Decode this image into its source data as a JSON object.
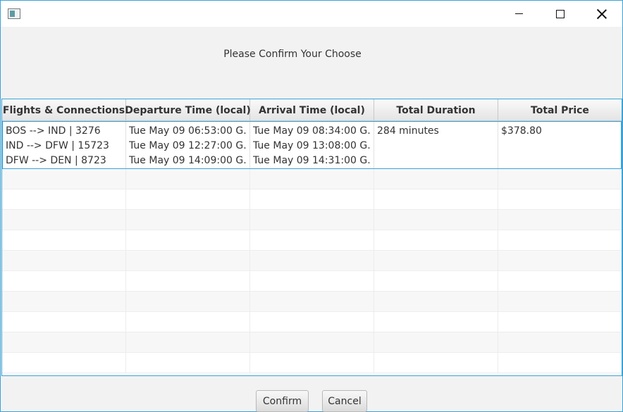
{
  "window": {
    "title": ""
  },
  "heading": "Please Confirm Your Choose",
  "table": {
    "columns": [
      "Flights & Connections",
      "Departure Time (local)",
      "Arrival Time (local)",
      "Total Duration",
      "Total Price"
    ],
    "row": {
      "flights": [
        "BOS --> IND  |  3276",
        "IND --> DFW  |  15723",
        "DFW --> DEN  |  8723"
      ],
      "departures": [
        "Tue May 09 06:53:00 G...",
        "Tue May 09 12:27:00 G...",
        "Tue May 09 14:09:00 G..."
      ],
      "arrivals": [
        "Tue May 09 08:34:00 G...",
        "Tue May 09 13:08:00 G...",
        "Tue May 09 14:31:00 G..."
      ],
      "duration": "284 minutes",
      "price": "$378.80"
    }
  },
  "buttons": {
    "confirm": "Confirm",
    "cancel": "Cancel"
  },
  "colors": {
    "accent": "#3aa3d8",
    "background": "#f2f2f2"
  }
}
